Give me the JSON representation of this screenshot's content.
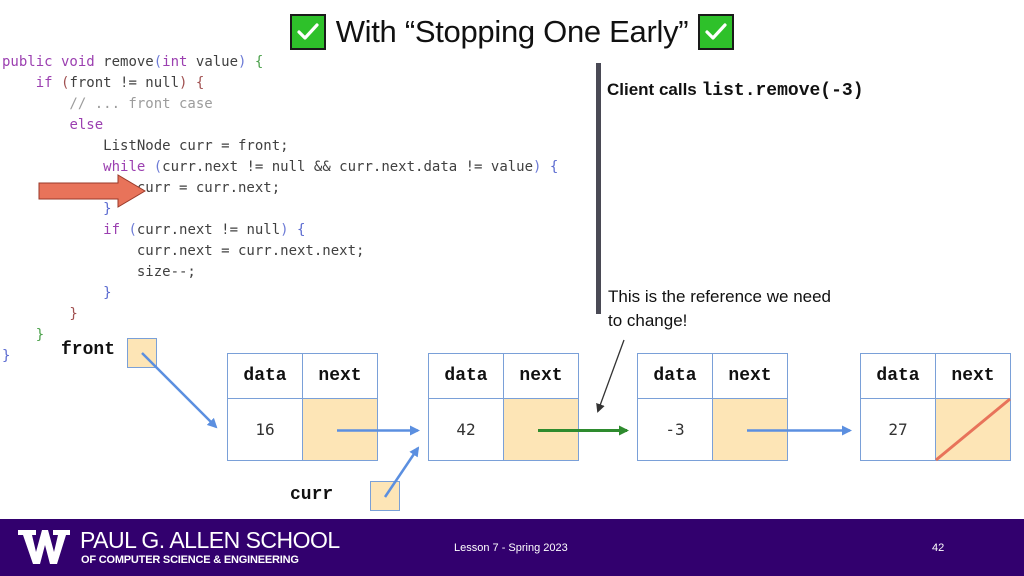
{
  "slide": {
    "title": "With “Stopping One Early”",
    "title_icons": [
      "check-box-icon",
      "check-box-icon"
    ]
  },
  "code": {
    "lines": [
      [
        {
          "t": "public void ",
          "c": "kw"
        },
        {
          "t": "remove",
          "c": ""
        },
        {
          "t": "(",
          "c": "par"
        },
        {
          "t": "int",
          "c": "kw"
        },
        {
          "t": " value",
          "c": ""
        },
        {
          "t": ")",
          "c": "par"
        },
        {
          "t": " {",
          "c": "brG"
        }
      ],
      [
        {
          "t": "    ",
          "c": ""
        },
        {
          "t": "if",
          "c": "kw"
        },
        {
          "t": " (",
          "c": "brR"
        },
        {
          "t": "front != null",
          "c": ""
        },
        {
          "t": ")",
          "c": "brR"
        },
        {
          "t": " {",
          "c": "brR"
        }
      ],
      [
        {
          "t": "        // ... front case",
          "c": "cm"
        }
      ],
      [
        {
          "t": "        ",
          "c": ""
        },
        {
          "t": "else",
          "c": "kw"
        }
      ],
      [
        {
          "t": "            ListNode curr = front;",
          "c": ""
        }
      ],
      [
        {
          "t": "            ",
          "c": ""
        },
        {
          "t": "while",
          "c": "kw"
        },
        {
          "t": " (",
          "c": "par"
        },
        {
          "t": "curr.next != null && curr.next.data != value",
          "c": ""
        },
        {
          "t": ")",
          "c": "par"
        },
        {
          "t": " {",
          "c": "brB"
        }
      ],
      [
        {
          "t": "                curr = curr.next;",
          "c": ""
        }
      ],
      [
        {
          "t": "            }",
          "c": "brB"
        }
      ],
      [
        {
          "t": "            ",
          "c": ""
        },
        {
          "t": "if",
          "c": "kw"
        },
        {
          "t": " (",
          "c": "par"
        },
        {
          "t": "curr.next != null",
          "c": ""
        },
        {
          "t": ")",
          "c": "par"
        },
        {
          "t": " {",
          "c": "brB"
        }
      ],
      [
        {
          "t": "                curr.next = curr.next.next;",
          "c": ""
        }
      ],
      [
        {
          "t": "                size--;",
          "c": ""
        }
      ],
      [
        {
          "t": "            }",
          "c": "brB"
        }
      ],
      [
        {
          "t": "        }",
          "c": "brR"
        }
      ],
      [
        {
          "t": "    }",
          "c": "brG"
        }
      ],
      [
        {
          "t": "}",
          "c": "brB"
        }
      ]
    ],
    "current_line_index": 6
  },
  "annotations": {
    "client_prefix": "Client calls ",
    "client_call": "list.remove(-3)",
    "note": "This is the reference we need to change!"
  },
  "diagram": {
    "front_label": "front",
    "curr_label": "curr",
    "header_data": "data",
    "header_next": "next",
    "nodes": [
      {
        "data": "16",
        "next_is_null": false
      },
      {
        "data": "42",
        "next_is_null": false
      },
      {
        "data": "-3",
        "next_is_null": false
      },
      {
        "data": "27",
        "next_is_null": true
      }
    ],
    "highlight_link_from_node": 1,
    "colors": {
      "pointer_arrow": "#5b8fe0",
      "highlight_arrow": "#2e8b2e",
      "null_slash": "#e8735a",
      "cell_fill": "#fde5b6",
      "cell_border": "#7aa0d8"
    }
  },
  "footer": {
    "school_line1": "PAUL G. ALLEN SCHOOL",
    "school_line2": "OF COMPUTER SCIENCE & ENGINEERING",
    "lesson": "Lesson 7 - Spring 2023",
    "page_number": "42",
    "bg_color": "#32006e"
  }
}
